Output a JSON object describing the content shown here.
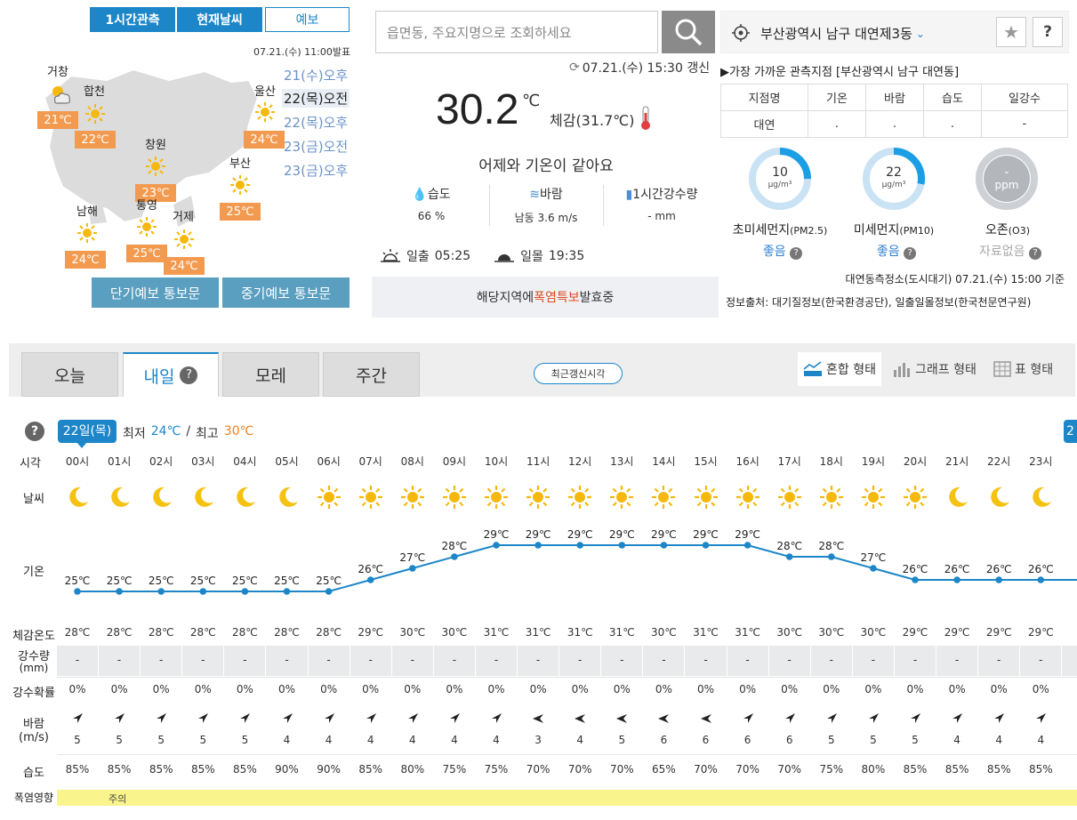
{
  "map": {
    "tabs": [
      "1시간관측",
      "현재날씨",
      "예보"
    ],
    "issued": "07.21.(수) 11:00발표",
    "times": [
      "21(수)오후",
      "22(목)오전",
      "22(목)오후",
      "23(금)오전",
      "23(금)오후"
    ],
    "cities": [
      {
        "name": "거창",
        "temp": "21℃",
        "icon": "partly-cloudy-icon"
      },
      {
        "name": "합천",
        "temp": "22℃",
        "icon": "sun-icon"
      },
      {
        "name": "울산",
        "temp": "24℃",
        "icon": "sun-icon"
      },
      {
        "name": "창원",
        "temp": "23℃",
        "icon": "sun-icon"
      },
      {
        "name": "부산",
        "temp": "25℃",
        "icon": "sun-icon"
      },
      {
        "name": "남해",
        "temp": "24℃",
        "icon": "sun-icon"
      },
      {
        "name": "통영",
        "temp": "25℃",
        "icon": "sun-icon"
      },
      {
        "name": "거제",
        "temp": "24℃",
        "icon": "sun-icon"
      }
    ],
    "buttons": [
      "단기예보 통보문",
      "중기예보 통보문"
    ]
  },
  "current": {
    "search_placeholder": "읍면동, 주요지명으로 조회하세요",
    "updated": "07.21.(수) 15:30 갱신",
    "temp": "30.2",
    "unit": "℃",
    "feels": "체감(31.7℃)",
    "compare": "어제와 기온이 같아요",
    "humidity_label": "습도",
    "humidity_value": "66 %",
    "wind_label": "바람",
    "wind_value": "남동 3.6 m/s",
    "rain_label": "1시간강수량",
    "rain_value": "- mm",
    "sunrise_label": "일출",
    "sunrise": "05:25",
    "sunset_label": "일몰",
    "sunset": "19:35",
    "alert_pre": "해당지역에 ",
    "alert_hl1": "폭염",
    "alert_mid": " ",
    "alert_hl2": "특보",
    "alert_post": " 발효중"
  },
  "location": {
    "name": "부산광역시 남구 대연제3동",
    "nearest": "▶가장 가까운 관측지점 [부산광역시 남구 대연동]",
    "table_headers": [
      "지점명",
      "기온",
      "바람",
      "습도",
      "일강수"
    ],
    "table_row": [
      "대연",
      ".",
      ".",
      ".",
      "-"
    ],
    "help": "?",
    "star": "★"
  },
  "air": {
    "pm25": {
      "value": "10",
      "unit": "μg/m³",
      "label": "초미세먼지",
      "sub": "(PM2.5)",
      "level": "좋음",
      "fraction": 0.25
    },
    "pm10": {
      "value": "22",
      "unit": "μg/m³",
      "label": "미세먼지",
      "sub": "(PM10)",
      "level": "좋음",
      "fraction": 0.28
    },
    "o3": {
      "value": "-",
      "unit": "ppm",
      "label": "오존",
      "sub": "(O3)",
      "level": "자료없음"
    },
    "station": "대연동측정소(도시대기) 07.21.(수) 15:00 기준",
    "source": "정보출처: 대기질정보(한국환경공단), 일출일몰정보(한국천문연구원)"
  },
  "tabs": [
    "오늘",
    "내일",
    "모레",
    "주간"
  ],
  "latest_btn": "최근갱신시각",
  "views": [
    "혼합 형태",
    "그래프 형태",
    "표 형태"
  ],
  "forecast": {
    "day_badge": "22일(목)",
    "min_label": "최저",
    "min": "24℃",
    "sep": "/",
    "max_label": "최고",
    "max": "30℃",
    "row_labels": {
      "time": "시각",
      "weather": "날씨",
      "temp": "기온",
      "feels": "체감온도",
      "rain": "강수량",
      "rain_unit": "(mm)",
      "pop": "강수확률",
      "wind": "바람",
      "wind_unit": "(m/s)",
      "humidity": "습도",
      "heat": "폭염영향"
    },
    "heat_value": "주의",
    "hours": [
      "00시",
      "01시",
      "02시",
      "03시",
      "04시",
      "05시",
      "06시",
      "07시",
      "08시",
      "09시",
      "10시",
      "11시",
      "12시",
      "13시",
      "14시",
      "15시",
      "16시",
      "17시",
      "18시",
      "19시",
      "20시",
      "21시",
      "22시",
      "23시"
    ],
    "weather": [
      "moon",
      "moon",
      "moon",
      "moon",
      "moon",
      "moon",
      "sun",
      "sun",
      "sun",
      "sun",
      "sun",
      "sun",
      "sun",
      "sun",
      "sun",
      "sun",
      "sun",
      "sun",
      "sun",
      "sun",
      "sun",
      "moon",
      "moon",
      "moon"
    ],
    "temps": [
      25,
      25,
      25,
      25,
      25,
      25,
      25,
      26,
      27,
      28,
      29,
      29,
      29,
      29,
      29,
      29,
      29,
      28,
      28,
      27,
      26,
      26,
      26,
      26
    ],
    "feels": [
      "28℃",
      "28℃",
      "28℃",
      "28℃",
      "28℃",
      "28℃",
      "28℃",
      "29℃",
      "30℃",
      "30℃",
      "31℃",
      "31℃",
      "31℃",
      "31℃",
      "30℃",
      "31℃",
      "31℃",
      "30℃",
      "30℃",
      "30℃",
      "29℃",
      "29℃",
      "29℃",
      "29℃"
    ],
    "rain": [
      "-",
      "-",
      "-",
      "-",
      "-",
      "-",
      "-",
      "-",
      "-",
      "-",
      "-",
      "-",
      "-",
      "-",
      "-",
      "-",
      "-",
      "-",
      "-",
      "-",
      "-",
      "-",
      "-",
      "-"
    ],
    "pop": [
      "0%",
      "0%",
      "0%",
      "0%",
      "0%",
      "0%",
      "0%",
      "0%",
      "0%",
      "0%",
      "0%",
      "0%",
      "0%",
      "0%",
      "0%",
      "0%",
      "0%",
      "0%",
      "0%",
      "0%",
      "0%",
      "0%",
      "0%",
      "0%"
    ],
    "wind_dir": [
      "ne",
      "ne",
      "ne",
      "ne",
      "ne",
      "ne",
      "ne",
      "ne",
      "ne",
      "ne",
      "ne",
      "w",
      "w",
      "w",
      "w",
      "w",
      "ne",
      "ne",
      "ne",
      "ne",
      "ne",
      "ne",
      "ne",
      "ne"
    ],
    "wind_speed": [
      "5",
      "5",
      "5",
      "5",
      "5",
      "4",
      "4",
      "4",
      "4",
      "4",
      "4",
      "3",
      "4",
      "5",
      "6",
      "6",
      "6",
      "6",
      "5",
      "5",
      "5",
      "4",
      "4",
      "4"
    ],
    "humidity": [
      "85%",
      "85%",
      "85%",
      "85%",
      "85%",
      "90%",
      "90%",
      "85%",
      "80%",
      "75%",
      "75%",
      "70%",
      "70%",
      "70%",
      "65%",
      "70%",
      "70%",
      "70%",
      "75%",
      "80%",
      "85%",
      "85%",
      "85%",
      "85%"
    ]
  },
  "colors": {
    "accent": "#1c86c8",
    "orange": "#f29a4f",
    "sun": "#f5b90d",
    "moon": "#f5c211"
  }
}
